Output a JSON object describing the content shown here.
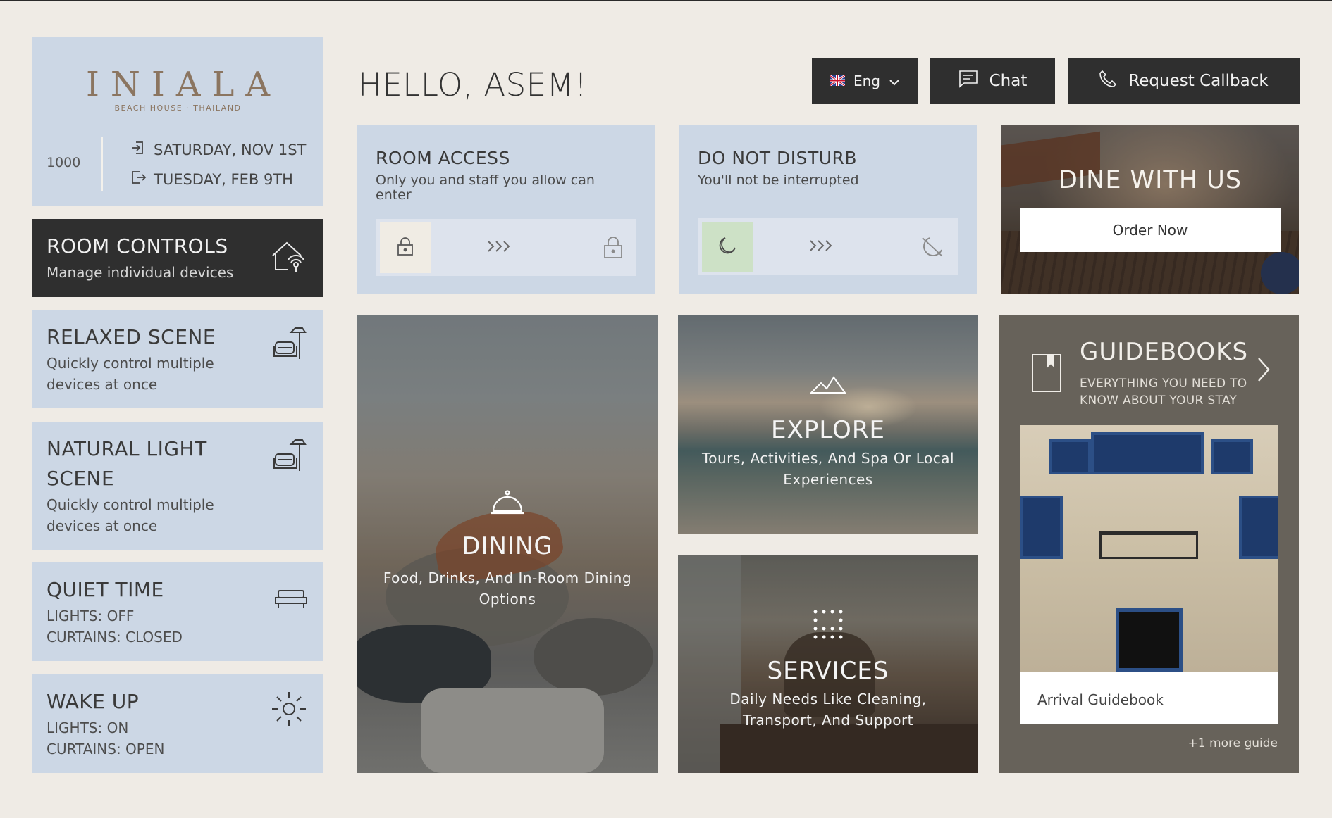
{
  "brand": {
    "logo": "INIALA",
    "tagline": "BEACH HOUSE · THAILAND",
    "room_number": "1000",
    "check_in": "SATURDAY, NOV 1ST",
    "check_out": "TUESDAY, FEB 9TH"
  },
  "greeting": "HELLO, ASEM!",
  "header": {
    "language": "Eng",
    "chat_label": "Chat",
    "callback_label": "Request Callback"
  },
  "scenes": {
    "room_controls": {
      "title": "ROOM CONTROLS",
      "subtitle": "Manage individual devices"
    },
    "relaxed": {
      "title": "RELAXED SCENE",
      "subtitle_1": "Quickly control multiple",
      "subtitle_2": "devices at once"
    },
    "natural": {
      "title_1": "NATURAL LIGHT",
      "title_2": "SCENE",
      "subtitle_1": "Quickly control multiple",
      "subtitle_2": "devices at once"
    },
    "quiet": {
      "title": "QUIET TIME",
      "line_1": "LIGHTS: OFF",
      "line_2": "CURTAINS: CLOSED"
    },
    "wake": {
      "title": "WAKE UP",
      "line_1": "LIGHTS: ON",
      "line_2": "CURTAINS: OPEN"
    }
  },
  "room_access": {
    "title": "ROOM ACCESS",
    "description": "Only you and staff you allow can enter"
  },
  "do_not_disturb": {
    "title": "DO NOT DISTURB",
    "description": "You'll not be interrupted"
  },
  "dine": {
    "title": "DINE WITH US",
    "button": "Order Now"
  },
  "dining": {
    "title": "DINING",
    "description": "Food, Drinks, And In-Room Dining Options"
  },
  "explore": {
    "title": "EXPLORE",
    "description": "Tours, Activities, And Spa Or Local Experiences"
  },
  "services": {
    "title": "SERVICES",
    "description": "Daily Needs Like Cleaning, Transport, And Support"
  },
  "guidebooks": {
    "title": "GUIDEBOOKS",
    "description": "EVERYTHING YOU NEED TO KNOW ABOUT YOUR STAY",
    "card_label": "Arrival Guidebook",
    "more": "+1 more guide"
  },
  "colors": {
    "background": "#efebe5",
    "card_blue": "#ccd7e5",
    "dark": "#2f2f2f",
    "brand_gold": "#8b7560",
    "guidebook_bg": "#67625a",
    "dnd_active": "#cde1c6"
  },
  "icons": {
    "check_in": "login-icon",
    "check_out": "logout-icon",
    "room_controls": "smart-home-icon",
    "relaxed": "armchair-lamp-icon",
    "natural": "armchair-lamp-icon",
    "quiet": "bed-icon",
    "wake": "sun-icon",
    "language": "uk-flag-icon",
    "chat": "chat-icon",
    "callback": "phone-icon",
    "lock": "lock-icon",
    "moon": "moon-icon",
    "dining": "cloche-icon",
    "explore": "mountain-icon",
    "services": "concierge-dots-icon",
    "guidebook": "bookmark-icon"
  }
}
